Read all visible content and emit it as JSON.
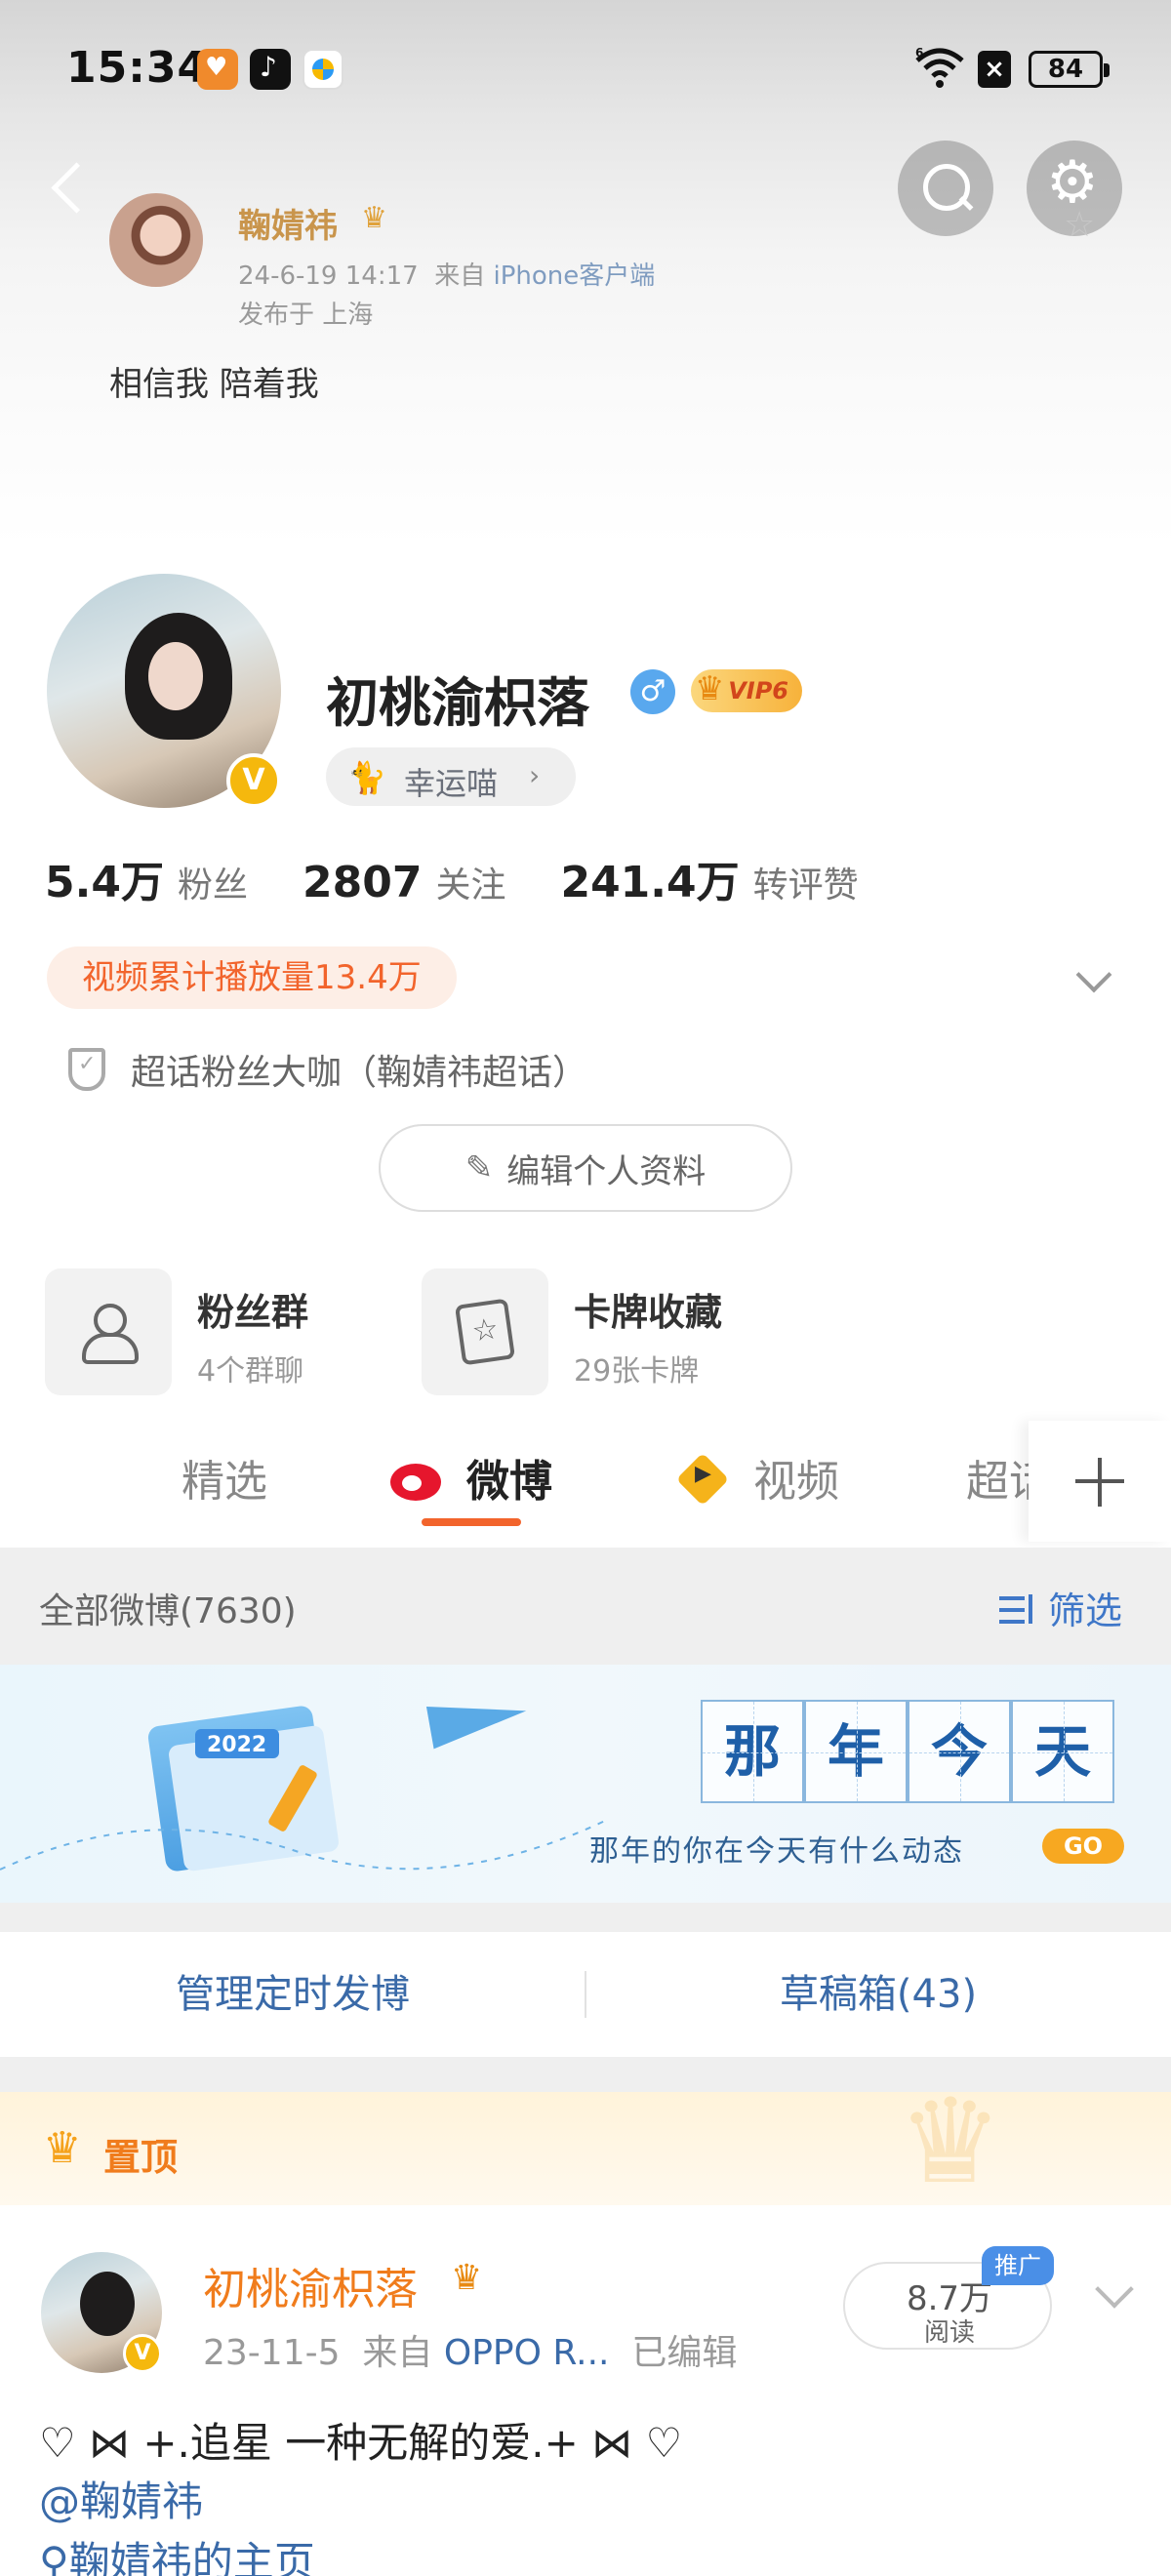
{
  "status_bar": {
    "time": "15:34",
    "battery": "84",
    "signal_label": "6"
  },
  "header_post": {
    "author": "鞠婧祎",
    "date": "24-6-19 14:17",
    "source_prefix": "来自",
    "source": "iPhone客户端",
    "location": "发布于 上海",
    "text": "相信我 陪着我"
  },
  "profile": {
    "nickname": "初桃渝枳落",
    "gender_symbol": "♂",
    "vip_label": "VIP6",
    "verified_mark": "V",
    "lucky_label": "幸运喵",
    "stats": [
      {
        "num": "5.4万",
        "label": "粉丝"
      },
      {
        "num": "2807",
        "label": "关注"
      },
      {
        "num": "241.4万",
        "label": "转评赞"
      }
    ],
    "video_plays": "视频累计播放量13.4万",
    "super_topic": "超话粉丝大咖（鞠婧祎超话）",
    "edit_label": "编辑个人资料"
  },
  "cards": [
    {
      "title": "粉丝群",
      "sub": "4个群聊"
    },
    {
      "title": "卡牌收藏",
      "sub": "29张卡牌"
    }
  ],
  "tabs": {
    "featured": "精选",
    "weibo": "微博",
    "video": "视频",
    "super": "超话"
  },
  "filter_bar": {
    "all_posts": "全部微博(7630)",
    "filter_label": "筛选"
  },
  "banner": {
    "title_chars": [
      "那",
      "年",
      "今",
      "天"
    ],
    "calendar_year": "2022",
    "subtitle": "那年的你在今天有什么动态",
    "go_label": "GO"
  },
  "manage": {
    "scheduled": "管理定时发博",
    "drafts": "草稿箱(43)"
  },
  "pinned": {
    "label": "置顶"
  },
  "post": {
    "author": "初桃渝枳落",
    "date": "23-11-5",
    "source_prefix": "来自",
    "source": "OPPO R...",
    "edited": "已编辑",
    "reads_num": "8.7万",
    "reads_label": "阅读",
    "promo_label": "推广",
    "text": "♡ ⋈ +.追星 一种无解的爱.+ ⋈ ♡",
    "mention": "@鞠婧祎",
    "link": "鞠婧祎的主页"
  },
  "colors": {
    "accent_orange": "#f2642c",
    "link_blue": "#3a6aa8",
    "vip_gold": "#f7b23b",
    "weibo_red": "#e6162d"
  }
}
